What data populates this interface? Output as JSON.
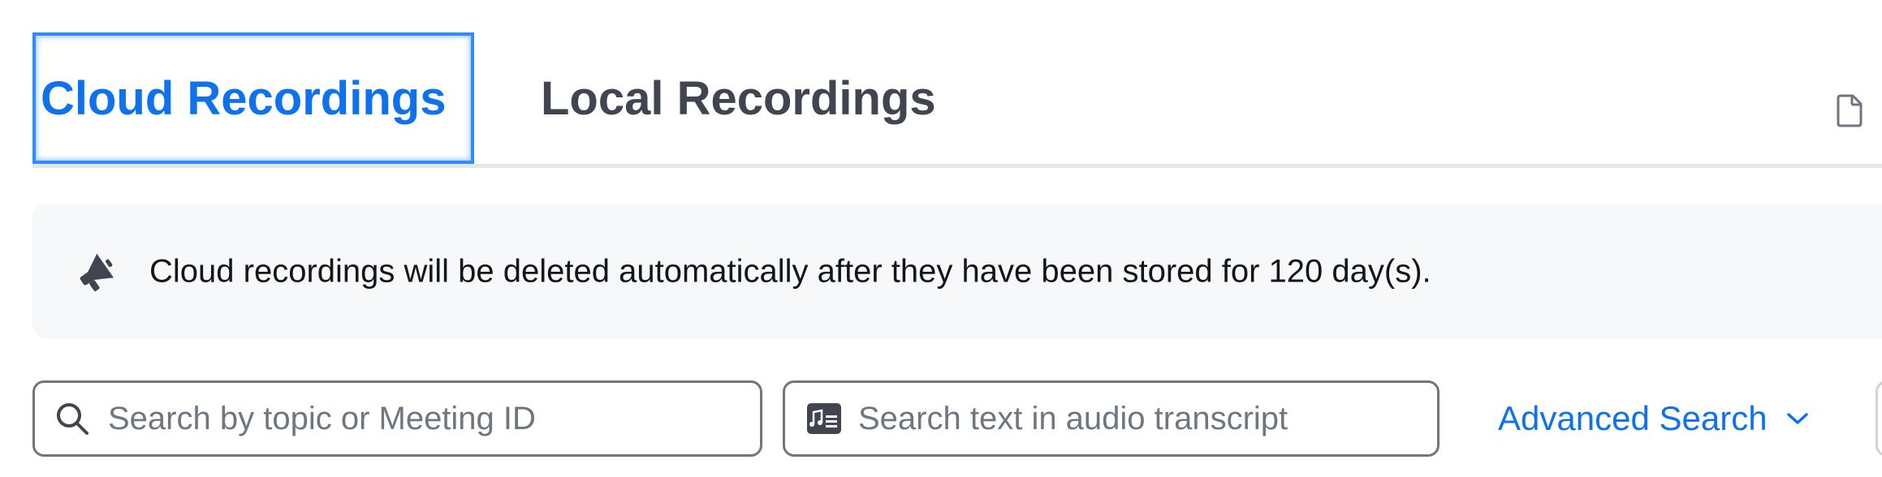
{
  "tabs": {
    "items": [
      {
        "label": "Cloud Recordings",
        "active": true
      },
      {
        "label": "Local Recordings",
        "active": false
      }
    ],
    "right_icon": "document-icon"
  },
  "notice": {
    "icon": "megaphone-icon",
    "text": "Cloud recordings will be deleted automatically after they have been stored for 120 day(s)."
  },
  "search": {
    "topic": {
      "icon": "search-icon",
      "placeholder": "Search by topic or Meeting ID",
      "value": ""
    },
    "transcript": {
      "icon": "transcript-search-icon",
      "placeholder": "Search text in audio transcript",
      "value": ""
    },
    "advanced": {
      "label": "Advanced Search",
      "icon": "chevron-down-icon"
    }
  },
  "colors": {
    "accent": "#0e72ed",
    "tab_inactive": "#40454f",
    "banner_bg": "#f7f8fa",
    "border": "#6e7680",
    "placeholder": "#6e7680"
  }
}
